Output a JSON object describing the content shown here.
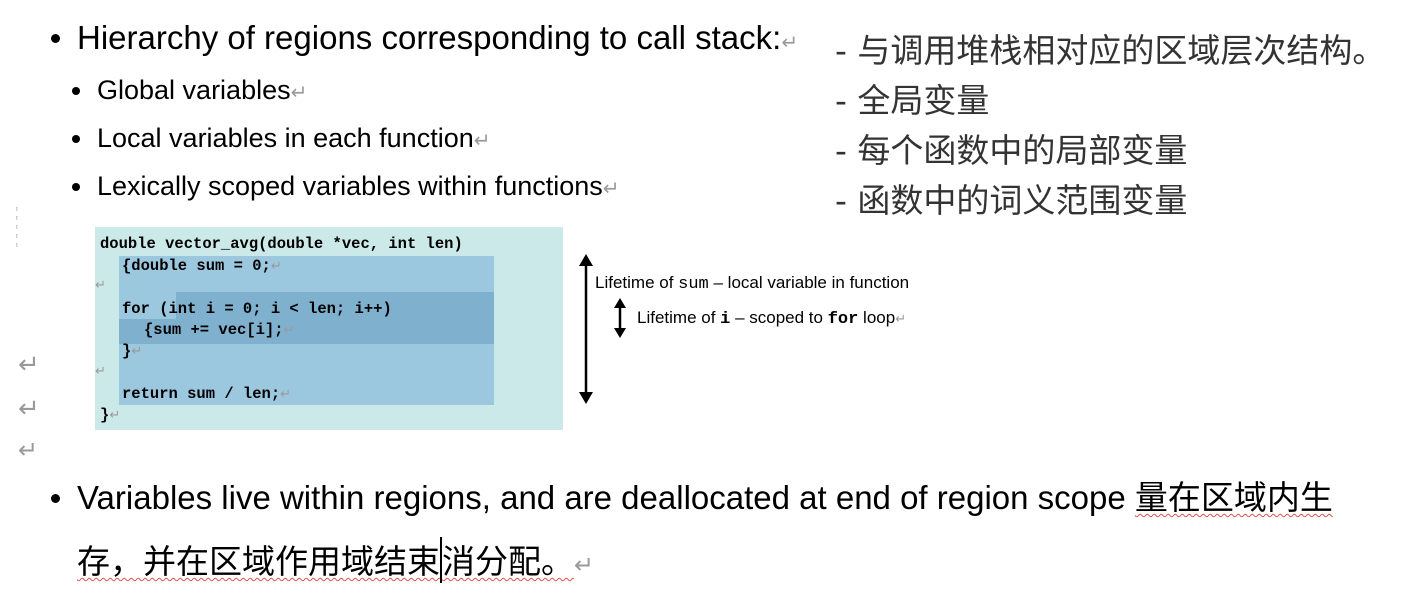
{
  "bullets": {
    "top": "Hierarchy of regions corresponding to call stack:",
    "sub": [
      "Global variables",
      "Local variables in each function",
      "Lexically scoped variables within functions"
    ],
    "bottom_en": "Variables live within regions, and are deallocated at end of region scope ",
    "bottom_zh_1": "量在区域内生",
    "bottom_zh_2": "存，并在区域作用域结束",
    "bottom_zh_3": "消分配。"
  },
  "translation": [
    "- 与调用堆栈相对应的区域层次结构。",
    "- 全局变量",
    "- 每个函数中的局部变量",
    "- 函数中的词义范围变量"
  ],
  "code": {
    "line1": "double vector_avg(double *vec, int len)",
    "line2": "{double sum = 0;",
    "line3": "for (int i = 0; i < len; i++)",
    "line4": "{sum += vec[i];",
    "line5": "}",
    "line6": "return sum / len;",
    "line7": "}"
  },
  "annotations": {
    "outer_prefix": "Lifetime of ",
    "outer_var": "sum",
    "outer_suffix": " – local variable in function",
    "inner_prefix": "Lifetime of ",
    "inner_var": "i",
    "inner_mid": " – scoped to ",
    "inner_kw": "for",
    "inner_suffix": " loop"
  },
  "return_mark": "↵",
  "icons": [
    "return-mark-icon",
    "double-arrow-icon"
  ],
  "colors": {
    "code_outer_bg": "#cce9ea",
    "code_inner_bg": "#9bc7df",
    "code_loop_bg": "#7fb1cf",
    "spell_underline": "#e05050",
    "translation_text": "#333333"
  }
}
